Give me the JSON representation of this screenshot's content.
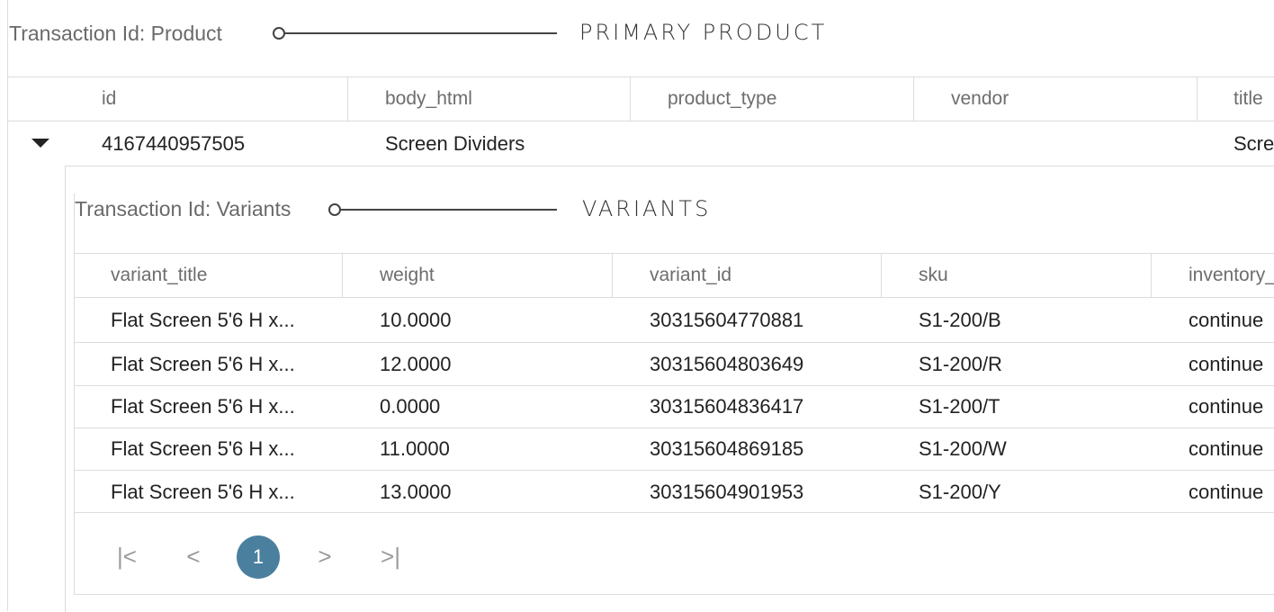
{
  "primary": {
    "txn_label": "Transaction Id: Product",
    "section_title": "PRIMARY PRODUCT",
    "columns": [
      "id",
      "body_html",
      "product_type",
      "vendor",
      "title"
    ],
    "row": {
      "id": "4167440957505",
      "body_html": "Screen Dividers",
      "product_type": "",
      "vendor": "",
      "title": "Scre"
    }
  },
  "variants": {
    "txn_label": "Transaction Id: Variants",
    "section_title": "VARIANTS",
    "columns": [
      "variant_title",
      "weight",
      "variant_id",
      "sku",
      "inventory_"
    ],
    "rows": [
      {
        "variant_title": "Flat Screen 5'6 H x...",
        "weight": "10.0000",
        "variant_id": "30315604770881",
        "sku": "S1-200/B",
        "inventory": "continue"
      },
      {
        "variant_title": "Flat Screen 5'6 H x...",
        "weight": "12.0000",
        "variant_id": "30315604803649",
        "sku": "S1-200/R",
        "inventory": "continue"
      },
      {
        "variant_title": "Flat Screen 5'6 H x...",
        "weight": "0.0000",
        "variant_id": "30315604836417",
        "sku": "S1-200/T",
        "inventory": "continue"
      },
      {
        "variant_title": "Flat Screen 5'6 H x...",
        "weight": "11.0000",
        "variant_id": "30315604869185",
        "sku": "S1-200/W",
        "inventory": "continue"
      },
      {
        "variant_title": "Flat Screen 5'6 H x...",
        "weight": "13.0000",
        "variant_id": "30315604901953",
        "sku": "S1-200/Y",
        "inventory": "continue"
      }
    ]
  },
  "pagination": {
    "first": "|<",
    "prev": "<",
    "current": "1",
    "next": ">",
    "last": ">|"
  },
  "colors": {
    "accent": "#4b7f9e",
    "border": "#dcdcdc"
  },
  "icons": {
    "expand": "caret-down-icon",
    "connector": "circle-line-connector"
  }
}
